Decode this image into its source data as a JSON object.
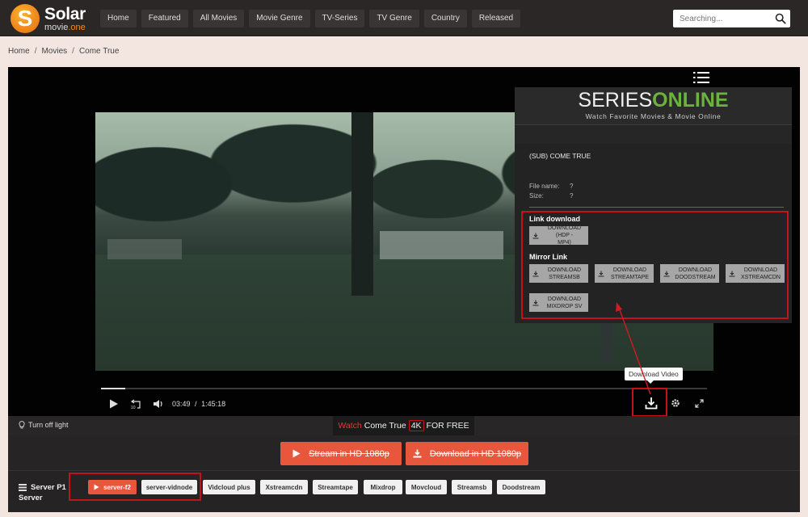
{
  "site": {
    "logo_letter": "S",
    "logo_title": "Solar",
    "logo_sub_main": "movie",
    "logo_sub_accent": ".one",
    "brand_color": "#f08a1c"
  },
  "nav": {
    "items": [
      {
        "label": "Home"
      },
      {
        "label": "Featured"
      },
      {
        "label": "All Movies"
      },
      {
        "label": "Movie Genre"
      },
      {
        "label": "TV-Series"
      },
      {
        "label": "TV Genre"
      },
      {
        "label": "Country"
      },
      {
        "label": "Released"
      }
    ],
    "search_placeholder": "Searching...",
    "search_icon": "search-icon"
  },
  "breadcrumb": {
    "items": [
      "Home",
      "Movies",
      "Come True"
    ],
    "separator": "/"
  },
  "player": {
    "progress_fraction": 0.04,
    "current_time": "03:49",
    "time_separator": "/",
    "duration": "1:45:18",
    "tooltip": "Download Video",
    "icons": [
      "play-icon",
      "rewind-10-icon",
      "volume-icon",
      "download-icon",
      "settings-icon",
      "fullscreen-icon",
      "menu-icon"
    ]
  },
  "series_online": {
    "brand_white": "SERIES",
    "brand_green": "ONLINE",
    "tagline": "Watch Favorite Movies &  Movie Online",
    "accent_color": "#6cb33e",
    "title": "(SUB) COME TRUE",
    "file_name_label": "File name:",
    "file_name_value": "?",
    "size_label": "Size:",
    "size_value": "?",
    "link_download_heading": "Link download",
    "main_download": {
      "line1": "DOWNLOAD (HDP -",
      "line2": "MP4)"
    },
    "mirror_heading": "Mirror Link",
    "mirrors": [
      {
        "line1": "DOWNLOAD",
        "line2": "STREAMSB"
      },
      {
        "line1": "DOWNLOAD",
        "line2": "STREAMTAPE"
      },
      {
        "line1": "DOWNLOAD",
        "line2": "DOODSTREAM"
      },
      {
        "line1": "DOWNLOAD",
        "line2": "XSTREAMCDN"
      },
      {
        "line1": "DOWNLOAD",
        "line2": "MIXDROP SV"
      }
    ]
  },
  "infobar": {
    "turn_off_light": "Turn off light",
    "watch_word": "Watch",
    "movie_title": "Come True",
    "quality_badge": "4K",
    "for_free": "FOR FREE"
  },
  "actions": {
    "stream": "Stream in HD 1080p",
    "download": "Download in HD 1080p",
    "button_color": "#e8573c"
  },
  "servers": {
    "label_line1": "Server P1",
    "label_line2": "Server",
    "items": [
      {
        "label": "server-f2",
        "active": true
      },
      {
        "label": "server-vidnode",
        "active": false
      },
      {
        "label": "Vidcloud plus",
        "active": false
      },
      {
        "label": "Xstreamcdn",
        "active": false
      },
      {
        "label": "Streamtape",
        "active": false
      },
      {
        "label": "Mixdrop",
        "active": false
      },
      {
        "label": "Movcloud",
        "active": false
      },
      {
        "label": "Streamsb",
        "active": false
      },
      {
        "label": "Doodstream",
        "active": false
      }
    ],
    "highlight_color": "#c4121c"
  }
}
